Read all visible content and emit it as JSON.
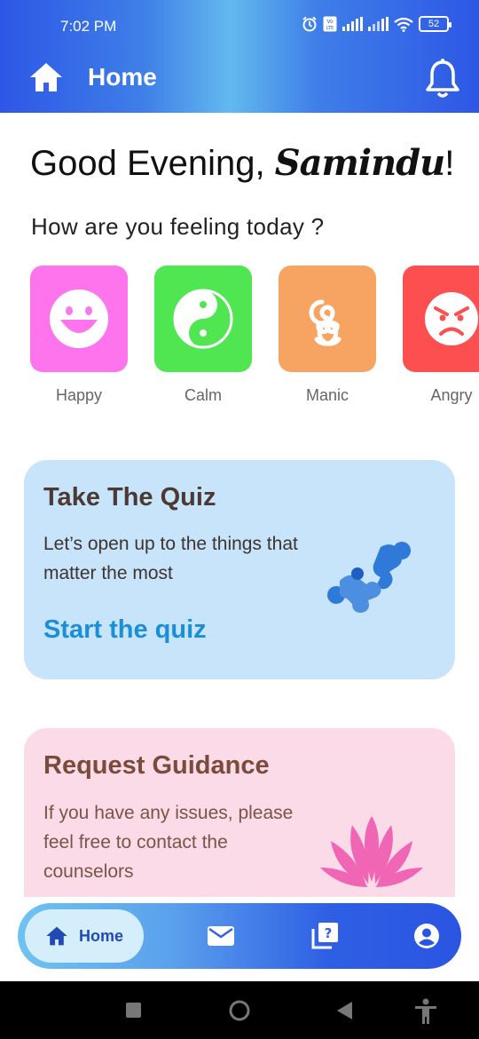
{
  "status_bar": {
    "time": "7:02 PM",
    "battery": "52",
    "icons": [
      "alarm-icon",
      "volte-icon",
      "signal-icon",
      "signal-icon",
      "wifi-icon",
      "battery-icon"
    ]
  },
  "app_bar": {
    "title": "Home",
    "left_icon": "home-icon",
    "right_icon": "bell-icon"
  },
  "greeting": {
    "prefix": "Good Evening, ",
    "name": "Samindu",
    "suffix": "!"
  },
  "feeling_question": "How are you feeling today ?",
  "moods": [
    {
      "label": "Happy",
      "icon": "smile-icon",
      "color": "#fd74ec"
    },
    {
      "label": "Calm",
      "icon": "yin-yang-icon",
      "color": "#4fe651"
    },
    {
      "label": "Manic",
      "icon": "spiral-icon",
      "color": "#f7a463"
    },
    {
      "label": "Angry",
      "icon": "angry-face-icon",
      "color": "#fd4f4f"
    }
  ],
  "quiz_card": {
    "title": "Take The Quiz",
    "text": "Let’s open up to the things that matter the most",
    "link": "Start the quiz",
    "color": "#c7e4fa"
  },
  "guidance_card": {
    "title": "Request Guidance",
    "text": "If you have any issues, please feel free to contact the counselors",
    "color": "#fadbe7"
  },
  "bottom_nav": {
    "items": [
      {
        "label": "Home",
        "icon": "home-icon",
        "active": true
      },
      {
        "label": "",
        "icon": "mail-icon"
      },
      {
        "label": "",
        "icon": "quiz-icon"
      },
      {
        "label": "",
        "icon": "profile-icon"
      }
    ]
  },
  "colors": {
    "header_blue": "#2d57e6",
    "accent_link": "#1a8fd8"
  }
}
